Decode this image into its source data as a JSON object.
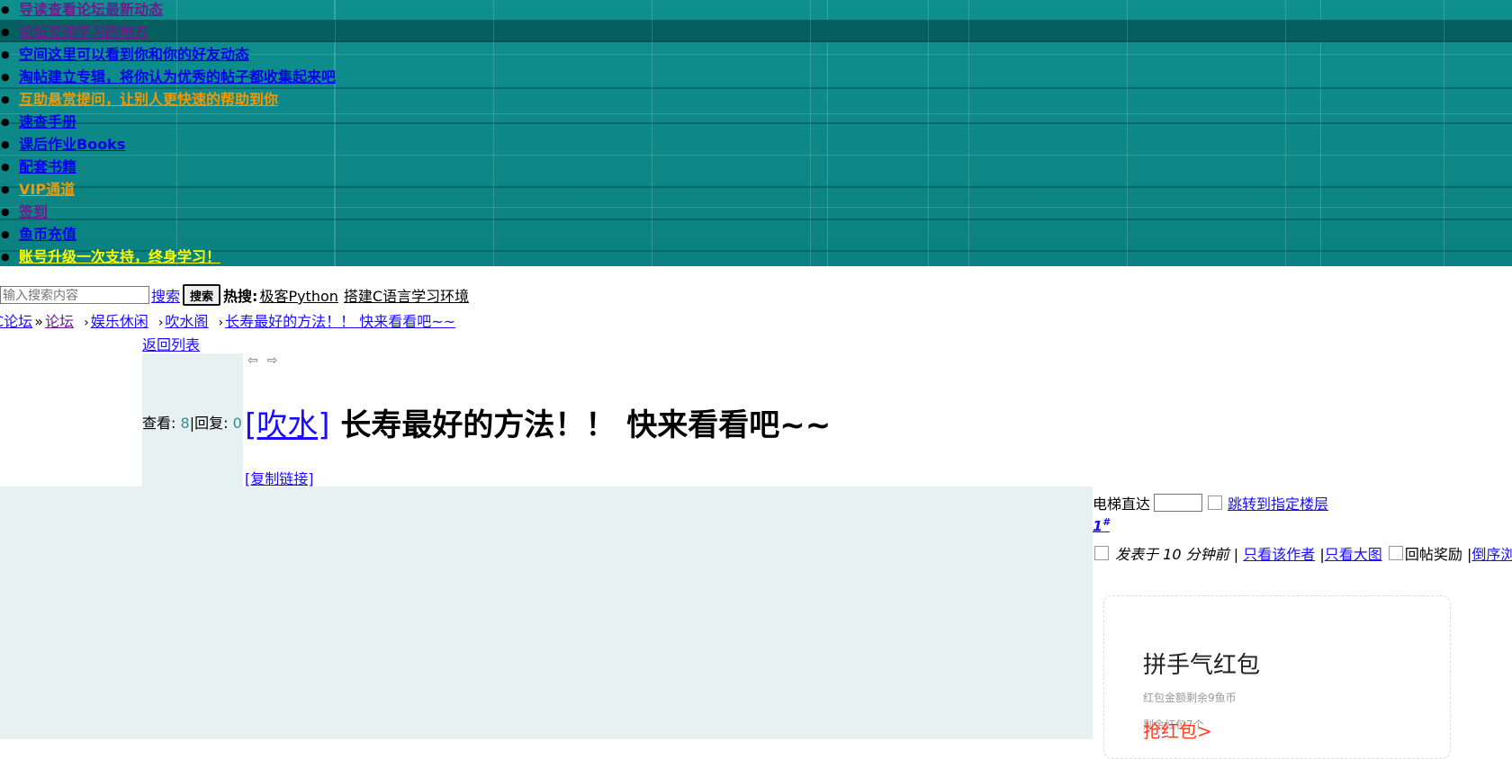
{
  "menu": {
    "items": [
      {
        "label": "导读查看论坛最新动态",
        "color": "#6b1d8b"
      },
      {
        "label": "论坛交流学习的地方",
        "color": "#6b1d8b"
      },
      {
        "label": "空间这里可以看到你和你的好友动态",
        "color": "#0000ee"
      },
      {
        "label": "淘帖建立专辑，将你认为优秀的帖子都收集起来吧",
        "color": "#0000ee"
      },
      {
        "label": "互助悬赏提问，让别人更快速的帮助到你",
        "color": "#f39800"
      },
      {
        "label": "速查手册",
        "color": "#0000ee"
      },
      {
        "label": "课后作业Books",
        "color": "#0000ee"
      },
      {
        "label": "配套书籍",
        "color": "#0000ee"
      },
      {
        "label": "VIP通道",
        "color": "#f39800"
      },
      {
        "label": "签到",
        "color": "#6b1d8b"
      },
      {
        "label": "鱼币充值",
        "color": "#0000ee"
      },
      {
        "label": "账号升级一次支持，终身学习！",
        "color": "#ffff00"
      }
    ]
  },
  "search": {
    "placeholder": "输入搜索内容",
    "link": "搜索",
    "button": "搜索",
    "hot_label": "热搜:",
    "hot_items": [
      "极客Python",
      "搭建C语言学习环境"
    ]
  },
  "breadcrumb": {
    "home": "C论坛",
    "sep": "»",
    "forum": "论坛",
    "arrow": "›",
    "category": "娱乐休闲",
    "board": "吹水阁",
    "thread": "长寿最好的方法！！ 快来看看吧~~"
  },
  "thread": {
    "back": "返回列表",
    "views_label": "查看:",
    "views": "8",
    "pipe": "|",
    "replies_label": "回复:",
    "replies": "0",
    "tag": "[吹水]",
    "title": "长寿最好的方法！！ 快来看看吧~~",
    "copy_link": "[复制链接]",
    "prev_icon": "⇦",
    "next_icon": "⇨"
  },
  "post": {
    "elevator_label": "电梯直达",
    "jump_label": "跳转到指定楼层",
    "floor": "1",
    "floor_mark": "#",
    "posted": "发表于 10 分钟前",
    "sep": "|",
    "only_author": "只看该作者",
    "only_image": "只看大图",
    "reward": "回帖奖励",
    "reverse": "倒序浏览"
  },
  "redpacket": {
    "title": "拼手气红包",
    "remaining": "红包金额剩余9鱼币",
    "count": "剩余红包7个",
    "grab": "抢红包>"
  },
  "colors": {
    "teal": "#0f8f8f",
    "panel": "#e8f1f1",
    "link": "#1a0dff",
    "red": "#ff3b1f"
  }
}
